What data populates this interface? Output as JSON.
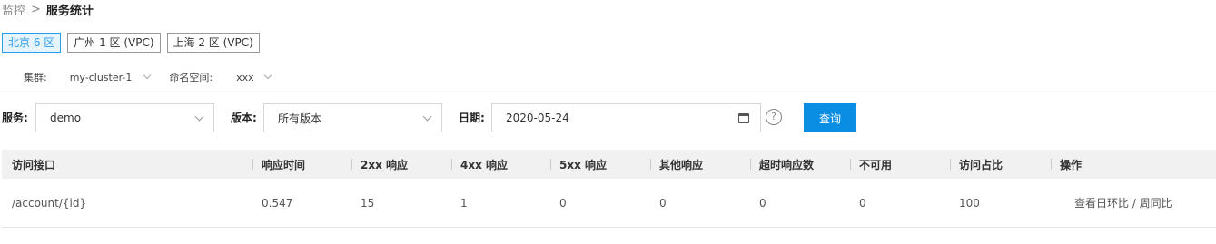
{
  "breadcrumb": {
    "parent": "监控",
    "separator": ">",
    "current": "服务统计"
  },
  "regions": [
    {
      "label": "北京 6 区",
      "active": true
    },
    {
      "label": "广州 1 区 (VPC)",
      "active": false
    },
    {
      "label": "上海 2 区 (VPC)",
      "active": false
    }
  ],
  "cluster": {
    "label": "集群:",
    "value": "my-cluster-1"
  },
  "namespace": {
    "label": "命名空间:",
    "value": "xxx"
  },
  "filters": {
    "service_label": "服务:",
    "service_value": "demo",
    "version_label": "版本:",
    "version_value": "所有版本",
    "date_label": "日期:",
    "date_value": "2020-05-24",
    "help_glyph": "?",
    "query_label": "查询"
  },
  "table": {
    "headers": [
      "访问接口",
      "响应时间",
      "2xx 响应",
      "4xx 响应",
      "5xx 响应",
      "其他响应",
      "超时响应数",
      "不可用",
      "访问占比",
      "操作"
    ],
    "rows": [
      {
        "cells": [
          "/account/{id}",
          "0.547",
          "15",
          "1",
          "0",
          "0",
          "0",
          "0",
          "100"
        ],
        "action": "查看日环比 / 周同比"
      }
    ]
  },
  "colors": {
    "accent": "#0a8ee3",
    "active_tab_bg": "#e6f4fd",
    "header_bg": "#f1f1f1"
  },
  "icons": {
    "dropdown": "chevron-down-icon",
    "date": "calendar-icon",
    "help": "help-circle-icon"
  }
}
